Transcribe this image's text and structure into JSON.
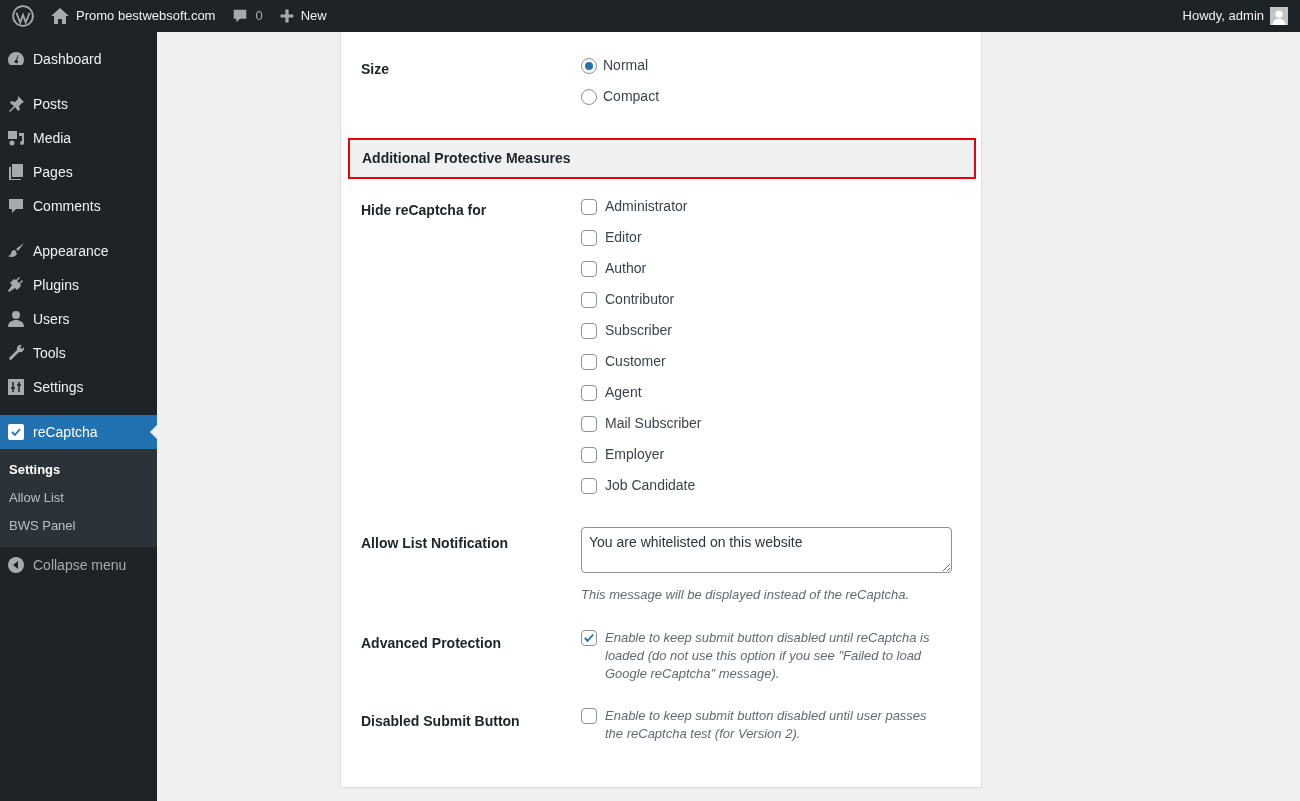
{
  "admin_bar": {
    "site_name": "Promo bestwebsoft.com",
    "comments_count": "0",
    "new_label": "New",
    "greeting": "Howdy, admin"
  },
  "sidebar": {
    "groups": [
      [
        {
          "label": "Dashboard",
          "selected": false
        }
      ],
      [
        {
          "label": "Posts",
          "selected": false
        },
        {
          "label": "Media",
          "selected": false
        },
        {
          "label": "Pages",
          "selected": false
        },
        {
          "label": "Comments",
          "selected": false
        }
      ],
      [
        {
          "label": "Appearance",
          "selected": false
        },
        {
          "label": "Plugins",
          "selected": false
        },
        {
          "label": "Users",
          "selected": false
        },
        {
          "label": "Tools",
          "selected": false
        },
        {
          "label": "Settings",
          "selected": false
        }
      ],
      [
        {
          "label": "reCaptcha",
          "selected": true
        }
      ]
    ],
    "submenu": [
      {
        "label": "Settings",
        "selected": true
      },
      {
        "label": "Allow List",
        "selected": false
      },
      {
        "label": "BWS Panel",
        "selected": false
      }
    ],
    "collapse_label": "Collapse menu"
  },
  "settings": [
    {
      "kind": "radio",
      "label": "Size",
      "options": [
        {
          "label": "Normal",
          "selected": true
        },
        {
          "label": "Compact",
          "selected": false
        }
      ]
    },
    {
      "kind": "section",
      "title": "Additional Protective Measures",
      "highlighted": true
    },
    {
      "kind": "checkboxes",
      "label": "Hide reCaptcha for",
      "options": [
        {
          "label": "Administrator",
          "checked": false
        },
        {
          "label": "Editor",
          "checked": false
        },
        {
          "label": "Author",
          "checked": false
        },
        {
          "label": "Contributor",
          "checked": false
        },
        {
          "label": "Subscriber",
          "checked": false
        },
        {
          "label": "Customer",
          "checked": false
        },
        {
          "label": "Agent",
          "checked": false
        },
        {
          "label": "Mail Subscriber",
          "checked": false
        },
        {
          "label": "Employer",
          "checked": false
        },
        {
          "label": "Job Candidate",
          "checked": false
        }
      ]
    },
    {
      "kind": "textarea",
      "label": "Allow List Notification",
      "value": "You are whitelisted on this website",
      "hint": "This message will be displayed instead of the reCaptcha."
    },
    {
      "kind": "checkbox",
      "label": "Advanced Protection",
      "checked": true,
      "description": "Enable to keep submit button disabled until reCaptcha is loaded (do not use this option if you see \"Failed to load Google reCaptcha\" message)."
    },
    {
      "kind": "checkbox",
      "label": "Disabled Submit Button",
      "checked": false,
      "description": "Enable to keep submit button disabled until user passes the reCaptcha test (for Version 2)."
    }
  ]
}
